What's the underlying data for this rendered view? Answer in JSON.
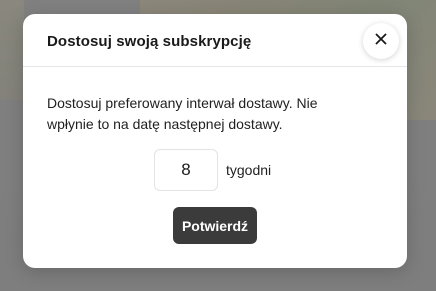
{
  "modal": {
    "title": "Dostosuj swoją subskrypcję",
    "close_icon": "close-icon",
    "description": "Dostosuj preferowany interwał dostawy. Nie wpłynie to na datę następnej dostawy.",
    "interval": {
      "value": "8",
      "unit_label": "tygodni"
    },
    "confirm_label": "Potwierdź"
  },
  "colors": {
    "overlay": "#8c8c8c",
    "modal_background": "#ffffff",
    "button_background": "#3b3b3b",
    "button_text": "#ffffff",
    "text": "#1f1f1f"
  }
}
